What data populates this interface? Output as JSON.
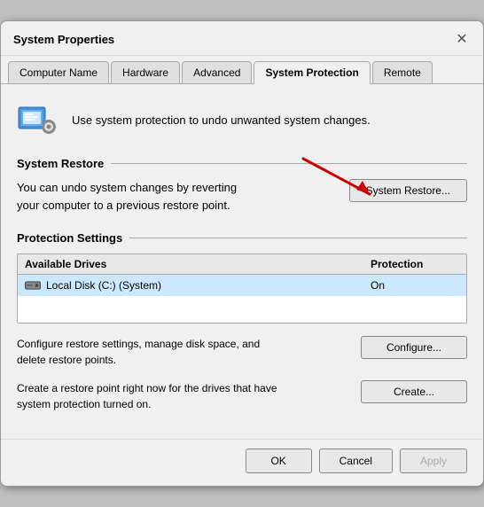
{
  "window": {
    "title": "System Properties",
    "close_label": "✕"
  },
  "tabs": [
    {
      "label": "Computer Name",
      "active": false
    },
    {
      "label": "Hardware",
      "active": false
    },
    {
      "label": "Advanced",
      "active": false
    },
    {
      "label": "System Protection",
      "active": true
    },
    {
      "label": "Remote",
      "active": false
    }
  ],
  "info": {
    "text": "Use system protection to undo unwanted system changes."
  },
  "system_restore_section": {
    "title": "System Restore",
    "description": "You can undo system changes by reverting your computer to a previous restore point.",
    "button_label": "System Restore..."
  },
  "protection_section": {
    "title": "Protection Settings",
    "columns": {
      "drives": "Available Drives",
      "protection": "Protection"
    },
    "rows": [
      {
        "drive": "Local Disk (C:) (System)",
        "protection": "On"
      }
    ]
  },
  "configure": {
    "text": "Configure restore settings, manage disk space, and delete restore points.",
    "button_label": "Configure..."
  },
  "create": {
    "text": "Create a restore point right now for the drives that have system protection turned on.",
    "button_label": "Create..."
  },
  "footer": {
    "ok_label": "OK",
    "cancel_label": "Cancel",
    "apply_label": "Apply"
  },
  "colors": {
    "accent": "#0078d4",
    "selected_row": "#cce8ff",
    "arrow": "#cc0000"
  }
}
